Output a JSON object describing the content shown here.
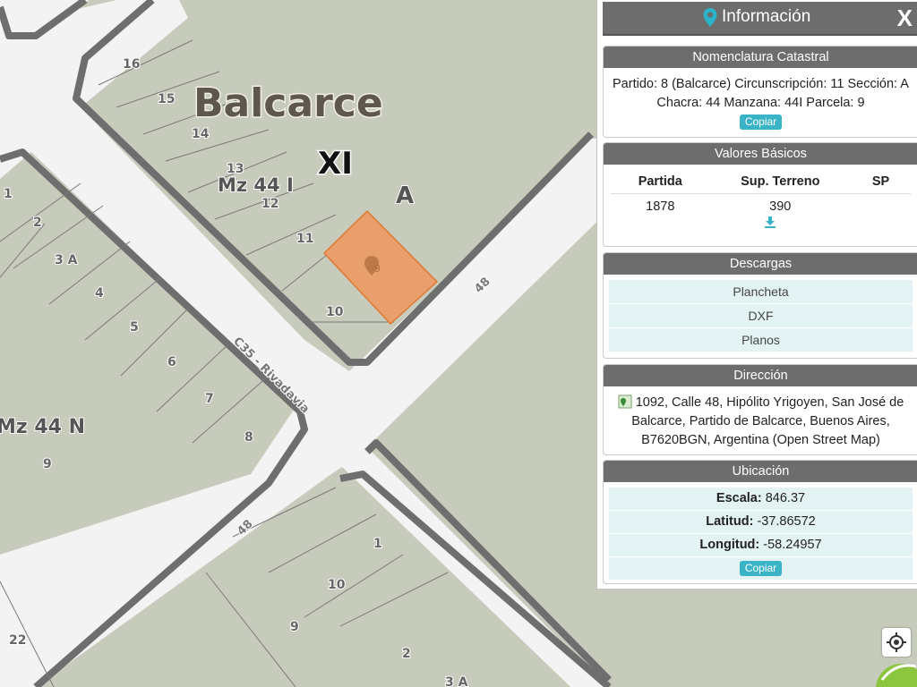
{
  "map": {
    "town_label": "Balcarce",
    "section_label": "XI",
    "subsection_label": "A",
    "manzana_top_label": "Mz 44 I",
    "manzana_left_label": "Mz 44 N",
    "street_label_top": "48",
    "street_label_bottom": "48",
    "street_label_diag": "C35 - Rivadavia",
    "selected_parcel_label": "9",
    "lot_numbers": {
      "n16": "16",
      "n15": "15",
      "n14": "14",
      "n13": "13",
      "n12": "12",
      "n11": "11",
      "n10": "10",
      "w1": "1",
      "w2": "2",
      "w3": "3 A",
      "w4": "4",
      "w5": "5",
      "w6": "6",
      "w7": "7",
      "w8": "8",
      "w9": "9",
      "s1": "1",
      "s10": "10",
      "s9": "9",
      "s2": "2",
      "s3": "3 A",
      "s22": "22"
    },
    "colors": {
      "background": "#c6cbbb",
      "road": "#f3f3f3",
      "block_outline": "#6e6e6e",
      "selected_parcel": "#ec9a64"
    }
  },
  "panel": {
    "title": "Información",
    "close_label": "X",
    "nomenclatura": {
      "header": "Nomenclatura Catastral",
      "line1": "Partido: 8 (Balcarce) Circunscripción: 11 Sección: A",
      "line2": "Chacra: 44 Manzana: 44I Parcela: 9",
      "copy_label": "Copiar"
    },
    "valores": {
      "header": "Valores Básicos",
      "columns": [
        "Partida",
        "Sup. Terreno",
        "SP"
      ],
      "row": [
        "1878",
        "390",
        ""
      ]
    },
    "descargas": {
      "header": "Descargas",
      "items": [
        "Plancheta",
        "DXF",
        "Planos"
      ]
    },
    "direccion": {
      "header": "Dirección",
      "line1": "1092, Calle 48, Hipólito Yrigoyen, San José de",
      "line2": "Balcarce, Partido de Balcarce, Buenos Aires,",
      "line3": "B7620BGN, Argentina (Open Street Map)"
    },
    "ubicacion": {
      "header": "Ubicación",
      "escala_label": "Escala:",
      "escala_value": "846.37",
      "latitud_label": "Latitud:",
      "latitud_value": "-37.86572",
      "longitud_label": "Longitud:",
      "longitud_value": "-58.24957",
      "copy_label": "Copiar"
    }
  }
}
